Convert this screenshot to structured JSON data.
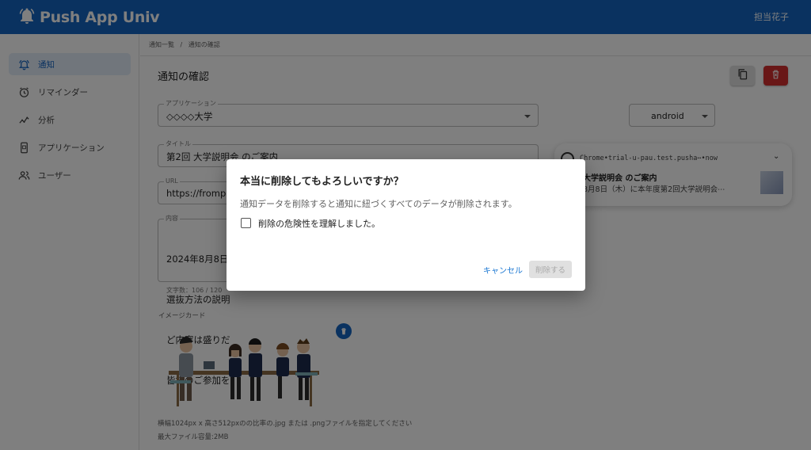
{
  "header": {
    "app_name": "Push App Univ",
    "user_name": "担当花子"
  },
  "sidebar": {
    "items": [
      {
        "label": "通知",
        "icon": "bell-icon",
        "active": true
      },
      {
        "label": "リマインダー",
        "icon": "alarm-icon",
        "active": false
      },
      {
        "label": "分析",
        "icon": "analytics-icon",
        "active": false
      },
      {
        "label": "アプリケーション",
        "icon": "app-device-icon",
        "active": false
      },
      {
        "label": "ユーザー",
        "icon": "users-icon",
        "active": false
      }
    ]
  },
  "breadcrumb": {
    "parent": "通知一覧",
    "separator": "/",
    "current": "通知の確認"
  },
  "page": {
    "title": "通知の確認"
  },
  "form": {
    "application": {
      "label": "アプリケーション",
      "value": "◇◇◇◇大学"
    },
    "platform": {
      "value": "android"
    },
    "title_field": {
      "label": "タイトル",
      "value": "第2回 大学説明会 のご案内"
    },
    "url_field": {
      "label": "URL",
      "value": "https://frompage"
    },
    "content_field": {
      "label": "内容",
      "lines": [
        "2024年8月8日",
        "選抜方法の説明",
        "ど内容は盛りだ",
        "皆様のご参加を"
      ]
    },
    "char_count": "文字数：106 / 120",
    "image_label": "イメージカード",
    "image_note1": "横幅1024px x 高さ512pxのの比率の.jpg または .pngファイルを指定してください",
    "image_note2": "最大ファイル容量:2MB"
  },
  "preview": {
    "header": "Chrome•trial-u-pau.test.pusha⋯•now",
    "title": "大学説明会 のご案内",
    "body": "8月8日（木）に本年度第2回大学説明会⋯"
  },
  "dialog": {
    "title": "本当に削除してもよろしいですか？",
    "message": "通知データを削除すると通知に紐づくすべてのデータが削除されます。",
    "checkbox_label": "削除の危険性を理解しました。",
    "checkbox_checked": false,
    "cancel_label": "キャンセル",
    "delete_label": "削除する",
    "delete_enabled": false
  },
  "colors": {
    "primary": "#1565c0",
    "danger": "#d32f2f",
    "active_bg": "#e3ecf9"
  }
}
